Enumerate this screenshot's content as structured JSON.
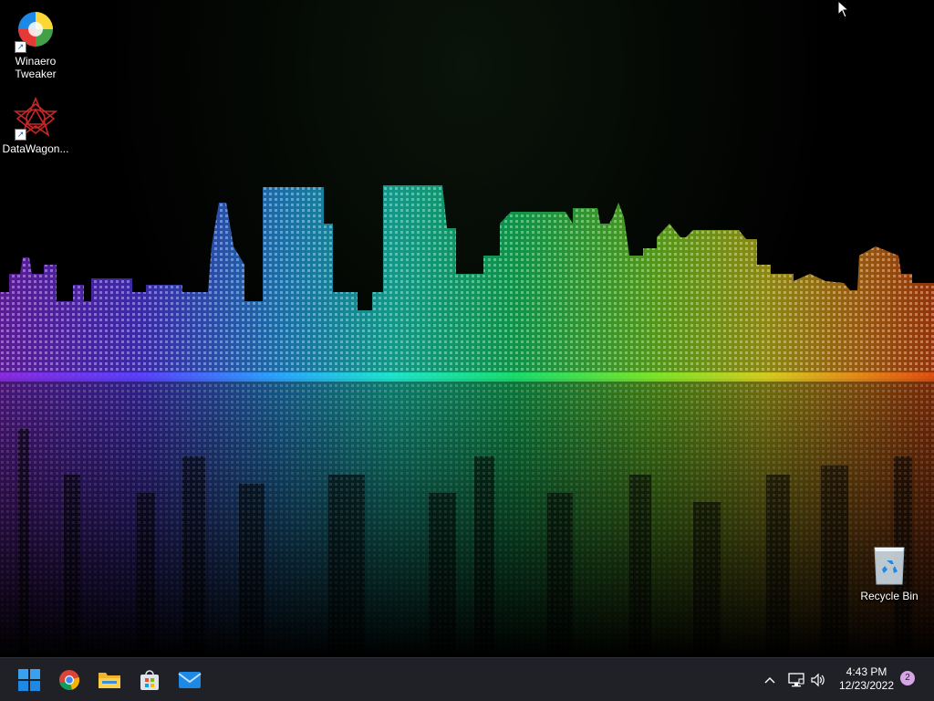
{
  "desktop": {
    "icons": [
      {
        "label_line1": "Winaero",
        "label_line2": "Tweaker",
        "icon": "winaero-tweaker-icon"
      },
      {
        "label": "DataWagon...",
        "icon": "datawagon-icon"
      },
      {
        "label": "Recycle Bin",
        "icon": "recycle-bin-icon"
      }
    ]
  },
  "taskbar": {
    "apps": [
      {
        "name": "Start",
        "icon": "windows-start-icon"
      },
      {
        "name": "Google Chrome",
        "icon": "chrome-icon"
      },
      {
        "name": "File Explorer",
        "icon": "folder-icon"
      },
      {
        "name": "Microsoft Store",
        "icon": "store-icon"
      },
      {
        "name": "Mail",
        "icon": "mail-icon"
      }
    ],
    "tray": {
      "time": "4:43 PM",
      "date": "12/23/2022",
      "notification_count": "2"
    }
  },
  "colors": {
    "taskbar_bg": "#1f2127",
    "accent_blue": "#0078d4",
    "badge": "#d7a4e8"
  }
}
